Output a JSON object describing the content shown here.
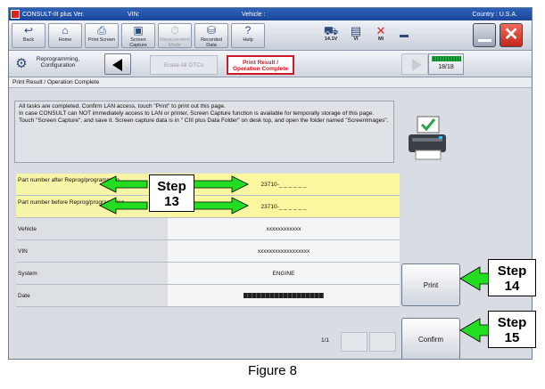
{
  "titlebar": {
    "app_name": "CONSULT-III plus  Ver.",
    "vin_label": "VIN:",
    "vehicle_label": "Vehicle :",
    "country": "Country : U.S.A."
  },
  "toolbar": {
    "buttons": [
      {
        "label": "Back",
        "icon": "back-arrow-icon"
      },
      {
        "label": "Home",
        "icon": "home-icon"
      },
      {
        "label": "Print Screen",
        "icon": "printer-icon"
      },
      {
        "label": "Screen Capture",
        "icon": "camera-icon"
      },
      {
        "label": "Measurement Mode",
        "icon": "measurement-icon"
      },
      {
        "label": "Recorded Data",
        "icon": "recorded-data-icon"
      },
      {
        "label": "Help",
        "icon": "help-icon"
      }
    ],
    "status": [
      {
        "label": "14.1V",
        "icon": "car-battery-icon"
      },
      {
        "label": "VI",
        "icon": "vi-icon"
      },
      {
        "label": "MI",
        "icon": "mi-icon"
      }
    ]
  },
  "navbar": {
    "crumb": "Reprogramming, Configuration",
    "prev_tab": "Erase All DTCs",
    "active_tab": "Print Result / Operation Complete",
    "page_indicator": "18/18"
  },
  "section_title": "Print Result / Operation Complete",
  "message": "All tasks are completed. Confirm LAN access, touch \"Print\" to print out this page.\nIn case CONSULT can NOT immediately access to LAN or printer, Screen Capture function is available for temporally storage of this page. Touch \"Screen Capture\", and save it. Screen capture data is in \" CIII plus Data Folder\" on desk top, and open the folder named \"ScreenImages\".",
  "table": {
    "rows": [
      {
        "label": "Part number after Reprog/programming",
        "value": "23710-_ _ _ _ _ _"
      },
      {
        "label": "Part number before Reprog/programming",
        "value": "23710-_ _ _ _ _ _"
      },
      {
        "label": "Vehicle",
        "value": "xxxxxxxxxxxx"
      },
      {
        "label": "VIN",
        "value": "xxxxxxxxxxxxxxxxxx"
      },
      {
        "label": "System",
        "value": "ENGINE"
      },
      {
        "label": "Date",
        "value": ""
      }
    ]
  },
  "pager": {
    "text": "1/1"
  },
  "side": {
    "print_label": "Print",
    "confirm_label": "Confirm"
  },
  "annotations": {
    "step13": "Step 13",
    "step14": "Step 14",
    "step15": "Step 15",
    "caption": "Figure 8"
  },
  "colors": {
    "titlebar": "#1b469a",
    "highlight_row": "#fbf7a0",
    "active_tab": "#d0182b",
    "arrow_green": "#22dd22"
  }
}
